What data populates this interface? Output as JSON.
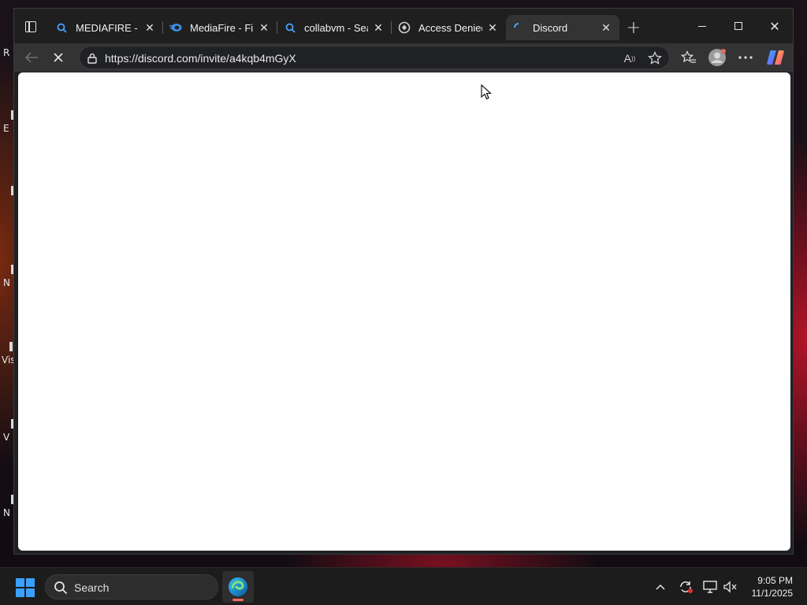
{
  "desktop": {
    "icon_labels": [
      "R",
      "E",
      "N",
      "Vis",
      "V",
      "N"
    ]
  },
  "browser": {
    "tabs": [
      {
        "label": "MEDIAFIRE - Se",
        "favicon": "search-icon",
        "active": false
      },
      {
        "label": "MediaFire - File",
        "favicon": "mediafire-icon",
        "active": false
      },
      {
        "label": "collabvm - Sear",
        "favicon": "search-icon",
        "active": false
      },
      {
        "label": "Access Denied",
        "favicon": "shield-icon",
        "active": false
      },
      {
        "label": "Discord",
        "favicon": "loading-icon",
        "active": true
      }
    ],
    "address": {
      "url": "https://discord.com/invite/a4kqb4mGyX"
    },
    "colors": {
      "titlebar": "#1f1f1f",
      "toolbar": "#333334",
      "page_bg": "#ffffff"
    }
  },
  "taskbar": {
    "search_placeholder": "Search",
    "time": "9:05 PM",
    "date": "11/1/2025",
    "edge_indicator_color": "#ff6b5a"
  }
}
